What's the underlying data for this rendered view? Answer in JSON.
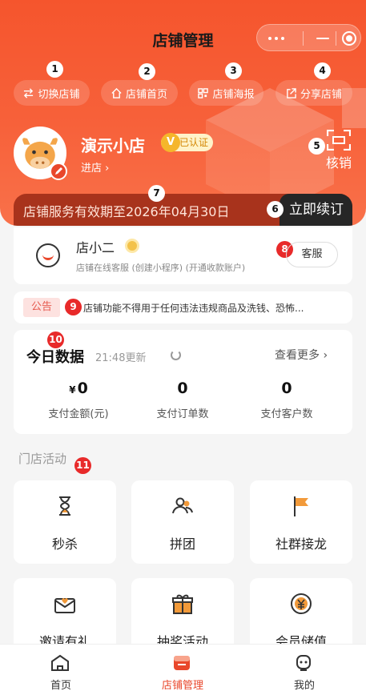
{
  "header": {
    "title": "店铺管理"
  },
  "quick_actions": [
    {
      "label": "切换店铺",
      "icon": "switch-icon"
    },
    {
      "label": "店铺首页",
      "icon": "home-icon"
    },
    {
      "label": "店铺海报",
      "icon": "qr-icon"
    },
    {
      "label": "分享店铺",
      "icon": "share-icon"
    }
  ],
  "markers": [
    "1",
    "2",
    "3",
    "4",
    "5",
    "6",
    "7",
    "8",
    "9",
    "10",
    "11"
  ],
  "shop": {
    "name": "演示小店",
    "verified": "已认证",
    "verified_mark": "V",
    "enter": "进店 ›",
    "hexiao": "核销"
  },
  "banner": {
    "text": "店铺服务有效期至2026年04月30日",
    "button": "立即续订"
  },
  "service": {
    "title": "店小二",
    "desc": "店铺在线客服 (创建小程序) (开通收款账户)",
    "button": "客服"
  },
  "notice": {
    "tag": "公告",
    "text": "店铺功能不得用于任何违法违规商品及洗钱、恐怖..."
  },
  "today": {
    "title": "今日数据",
    "update": "21:48更新",
    "more": "查看更多 ›",
    "currency": "¥",
    "stats": [
      {
        "value": "0",
        "label": "支付金额(元)"
      },
      {
        "value": "0",
        "label": "支付订单数"
      },
      {
        "value": "0",
        "label": "支付客户数"
      }
    ]
  },
  "activities": {
    "title": "门店活动",
    "items": [
      {
        "label": "秒杀",
        "icon": "hourglass-icon"
      },
      {
        "label": "拼团",
        "icon": "group-icon"
      },
      {
        "label": "社群接龙",
        "icon": "flag-icon"
      },
      {
        "label": "邀请有礼",
        "icon": "gift-letter-icon"
      },
      {
        "label": "抽奖活动",
        "icon": "gift-box-icon"
      },
      {
        "label": "会员储值",
        "icon": "yen-coin-icon"
      }
    ]
  },
  "tabbar": [
    {
      "label": "首页",
      "icon": "home-tab-icon"
    },
    {
      "label": "店铺管理",
      "icon": "shop-tab-icon"
    },
    {
      "label": "我的",
      "icon": "profile-tab-icon"
    }
  ],
  "colors": {
    "brand": "#f5552d",
    "accent": "#e9472b",
    "badge": "#e82a2a"
  }
}
